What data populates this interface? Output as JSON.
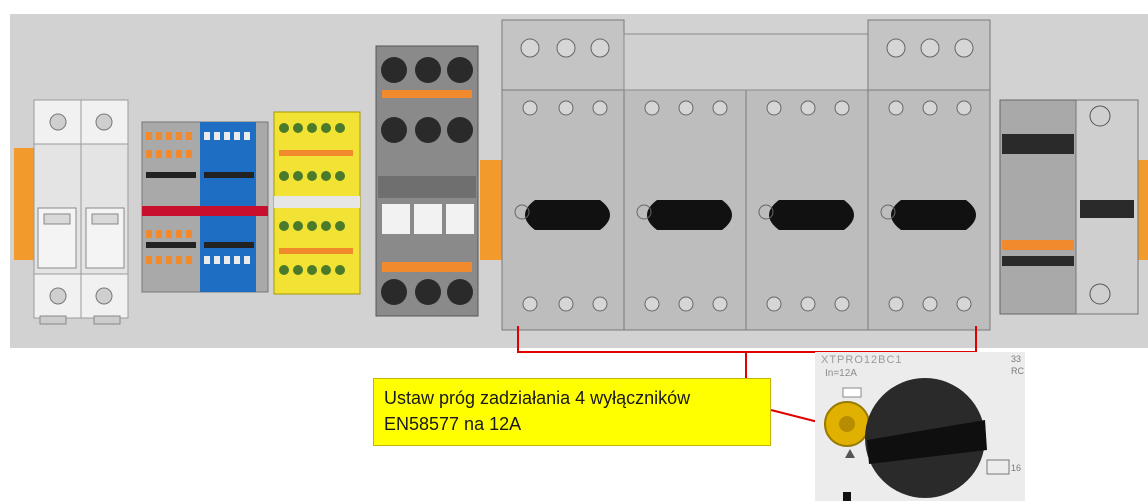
{
  "callout": {
    "line1": "Ustaw próg zadziałania 4 wyłączników",
    "line2": "EN58577 na 12A"
  },
  "detail": {
    "model": "XTPRO12BC1",
    "rating": "In=12A",
    "corner_top": "33",
    "corner_mid": "RC",
    "corner_bot": "16"
  },
  "colors": {
    "callout_fill": "#ffff00",
    "connector_line": "#e00000",
    "din_rail": "#f39a2c",
    "terminal_blue": "#1e6fc4",
    "terminal_yellow": "#f2e234",
    "terminal_orange": "#f08a2c",
    "breaker_body": "#bdbdbd",
    "handle": "#111111"
  }
}
